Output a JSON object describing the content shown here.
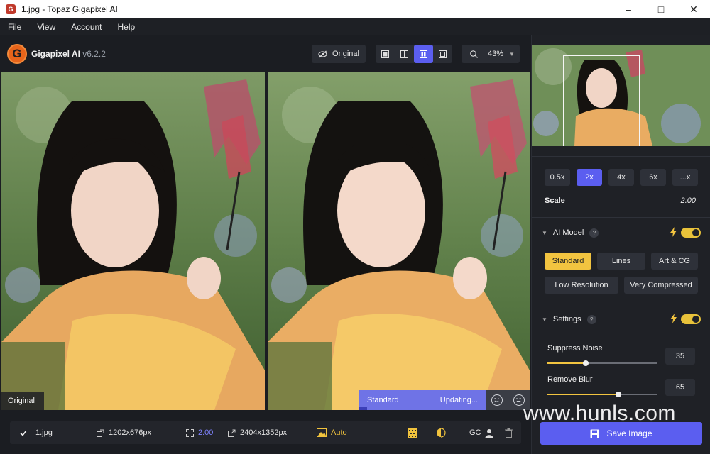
{
  "window": {
    "title": "1.jpg - Topaz Gigapixel AI"
  },
  "menu": {
    "items": [
      "File",
      "View",
      "Account",
      "Help"
    ]
  },
  "toolbar": {
    "brand_name": "Gigapixel AI",
    "version": "v6.2.2",
    "original_button": "Original",
    "zoom": "43%"
  },
  "preview": {
    "left_label": "Original",
    "model_status": "Standard",
    "progress_status": "Updating...",
    "progress_fraction": 0.06
  },
  "bottom": {
    "filename": "1.jpg",
    "input_size": "1202x676px",
    "scale": "2.00",
    "output_size": "2404x1352px",
    "auto_label": "Auto",
    "gc_label": "GC"
  },
  "panel": {
    "scale_options": [
      "0.5x",
      "2x",
      "4x",
      "6x",
      "...x"
    ],
    "scale_selected": "2x",
    "scale_label": "Scale",
    "scale_value": "2.00",
    "ai_model_label": "AI Model",
    "help_mark": "?",
    "models_row1": [
      "Standard",
      "Lines",
      "Art & CG"
    ],
    "models_row2": [
      "Low Resolution",
      "Very Compressed"
    ],
    "model_selected": "Standard",
    "settings_label": "Settings",
    "suppress_noise_label": "Suppress Noise",
    "suppress_noise_value": "35",
    "remove_blur_label": "Remove Blur",
    "remove_blur_value": "65",
    "save_label": "Save Image"
  },
  "watermark": "www.hunls.com",
  "colors": {
    "accent": "#5b5ef0",
    "highlight": "#f2c440",
    "brand": "#e8641a"
  }
}
